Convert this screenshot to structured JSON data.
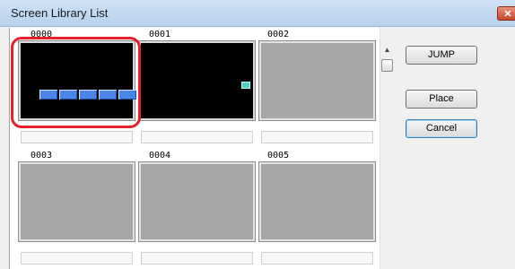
{
  "window": {
    "title": "Screen Library List",
    "close_glyph": "✕"
  },
  "screens": [
    {
      "id": "0000",
      "preview": "black",
      "selected": true
    },
    {
      "id": "0001",
      "preview": "black",
      "selected": false
    },
    {
      "id": "0002",
      "preview": "gray",
      "selected": false
    },
    {
      "id": "0003",
      "preview": "gray",
      "selected": false
    },
    {
      "id": "0004",
      "preview": "gray",
      "selected": false
    },
    {
      "id": "0005",
      "preview": "gray",
      "selected": false
    }
  ],
  "buttons": {
    "jump": "JUMP",
    "place": "Place",
    "cancel": "Cancel"
  },
  "scrollbar": {
    "up_arrow": "▲"
  },
  "colors": {
    "highlight": "#e8202a",
    "block": "#4a86e8",
    "marker": "#4fd1c5"
  }
}
